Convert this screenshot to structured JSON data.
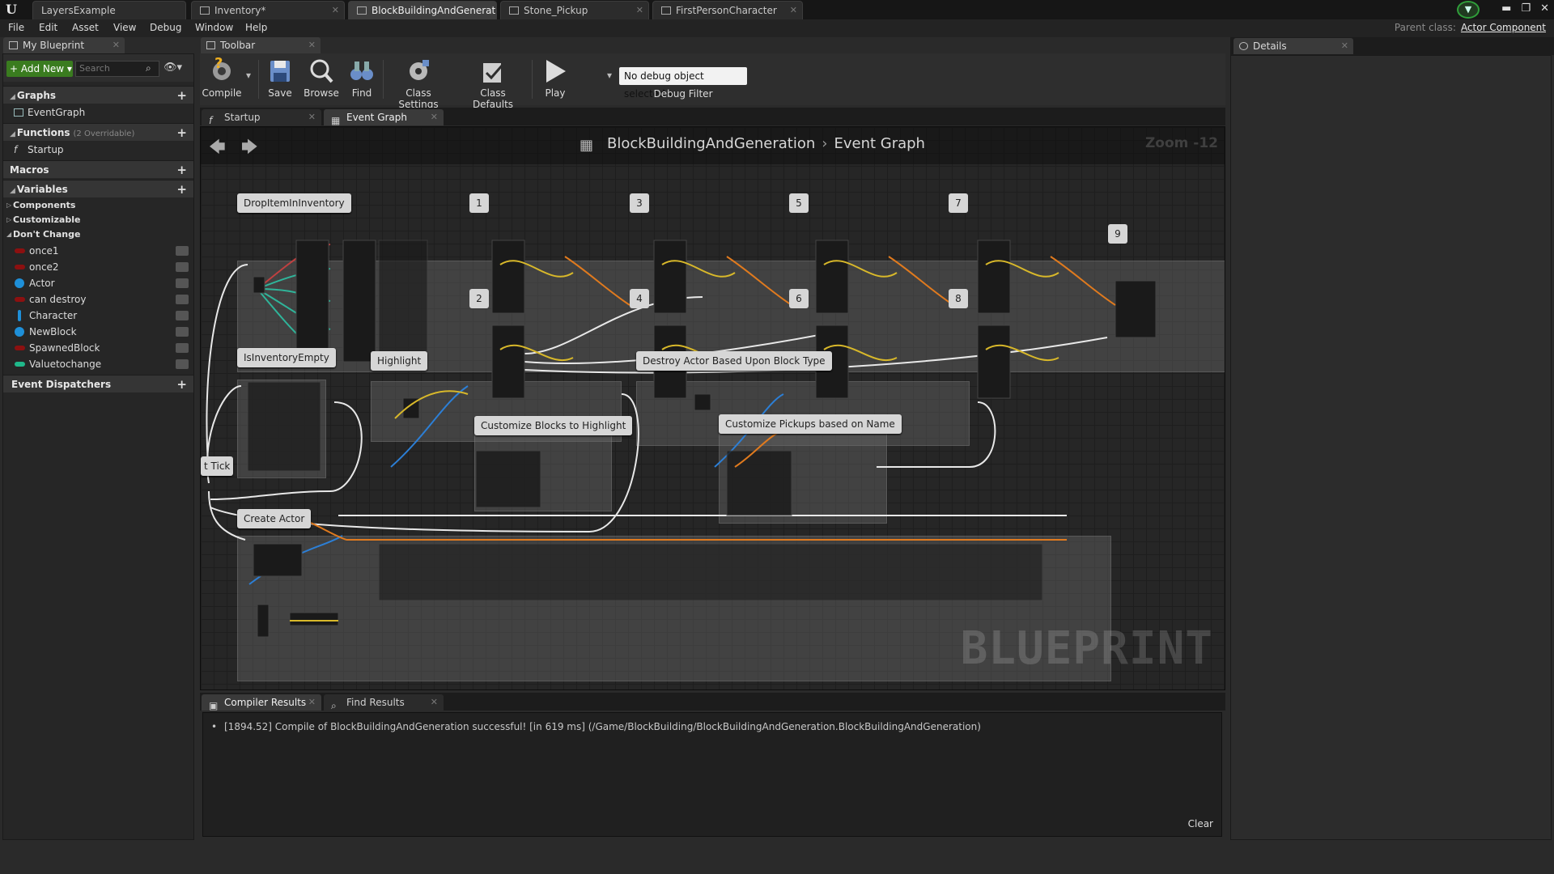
{
  "tabs": [
    {
      "label": "LayersExample",
      "active": false
    },
    {
      "label": "Inventory*",
      "active": false
    },
    {
      "label": "BlockBuildingAndGenerat",
      "active": true
    },
    {
      "label": "Stone_Pickup",
      "active": false
    },
    {
      "label": "FirstPersonCharacter",
      "active": false
    }
  ],
  "app_logo": "U",
  "menu": [
    "File",
    "Edit",
    "Asset",
    "View",
    "Debug",
    "Window",
    "Help"
  ],
  "parent_class": {
    "label": "Parent class:",
    "value": "Actor Component"
  },
  "my_blueprint": {
    "tab_label": "My Blueprint",
    "add_new": "+ Add New",
    "search_placeholder": "Search",
    "sections": {
      "graphs": "Graphs",
      "functions": "Functions",
      "functions_sub": "(2 Overridable)",
      "macros": "Macros",
      "variables": "Variables",
      "event_dispatchers": "Event Dispatchers"
    },
    "graphs": [
      "EventGraph"
    ],
    "functions": [
      "Startup"
    ],
    "categories": [
      "Components",
      "Customizable",
      "Don't Change"
    ],
    "variables": [
      {
        "name": "once1",
        "color": "#8c1010"
      },
      {
        "name": "once2",
        "color": "#8c1010"
      },
      {
        "name": "Actor",
        "color": "#1e8fd8"
      },
      {
        "name": "can destroy",
        "color": "#8c1010"
      },
      {
        "name": "Character",
        "color": "#1e8fd8"
      },
      {
        "name": "NewBlock",
        "color": "#1e8fd8"
      },
      {
        "name": "SpawnedBlock",
        "color": "#8c1010"
      },
      {
        "name": "Valuetochange",
        "color": "#1fb88a"
      }
    ]
  },
  "toolbar": {
    "tab_label": "Toolbar",
    "compile": "Compile",
    "save": "Save",
    "browse": "Browse",
    "find": "Find",
    "class_settings": "Class Settings",
    "class_defaults": "Class Defaults",
    "play": "Play",
    "debug_select": "No debug object selected",
    "debug_filter": "Debug Filter"
  },
  "graph_tabs": [
    {
      "label": "Startup",
      "icon": "function-icon",
      "active": false
    },
    {
      "label": "Event Graph",
      "icon": "graph-icon",
      "active": true
    }
  ],
  "graph": {
    "breadcrumb_root": "BlockBuildingAndGeneration",
    "breadcrumb_current": "Event Graph",
    "zoom": "Zoom -12",
    "watermark": "BLUEPRINT",
    "comments": {
      "drop_item": "DropItemInInventory",
      "is_inventory_empty": "IsInventoryEmpty",
      "highlight": "Highlight",
      "destroy_actor": "Destroy Actor Based Upon Block Type",
      "customize_blocks": "Customize Blocks to Highlight",
      "customize_pickups": "Customize Pickups based on Name",
      "create_actor": "Create Actor",
      "event_tick": "t Tick"
    },
    "numbers": [
      "1",
      "2",
      "3",
      "4",
      "5",
      "6",
      "7",
      "8",
      "9"
    ]
  },
  "results": {
    "tabs": [
      "Compiler Results",
      "Find Results"
    ],
    "message": "[1894.52] Compile of BlockBuildingAndGeneration successful! [in 619 ms] (/Game/BlockBuilding/BlockBuildingAndGeneration.BlockBuildingAndGeneration)",
    "clear": "Clear"
  },
  "details": {
    "tab_label": "Details"
  },
  "colors": {
    "accent_green": "#3a7c1f",
    "wire_white": "#e8e8e8",
    "wire_orange": "#e07a1e",
    "wire_yellow": "#d8b82a",
    "wire_teal": "#2fb59a",
    "wire_blue": "#2c7fd6"
  }
}
